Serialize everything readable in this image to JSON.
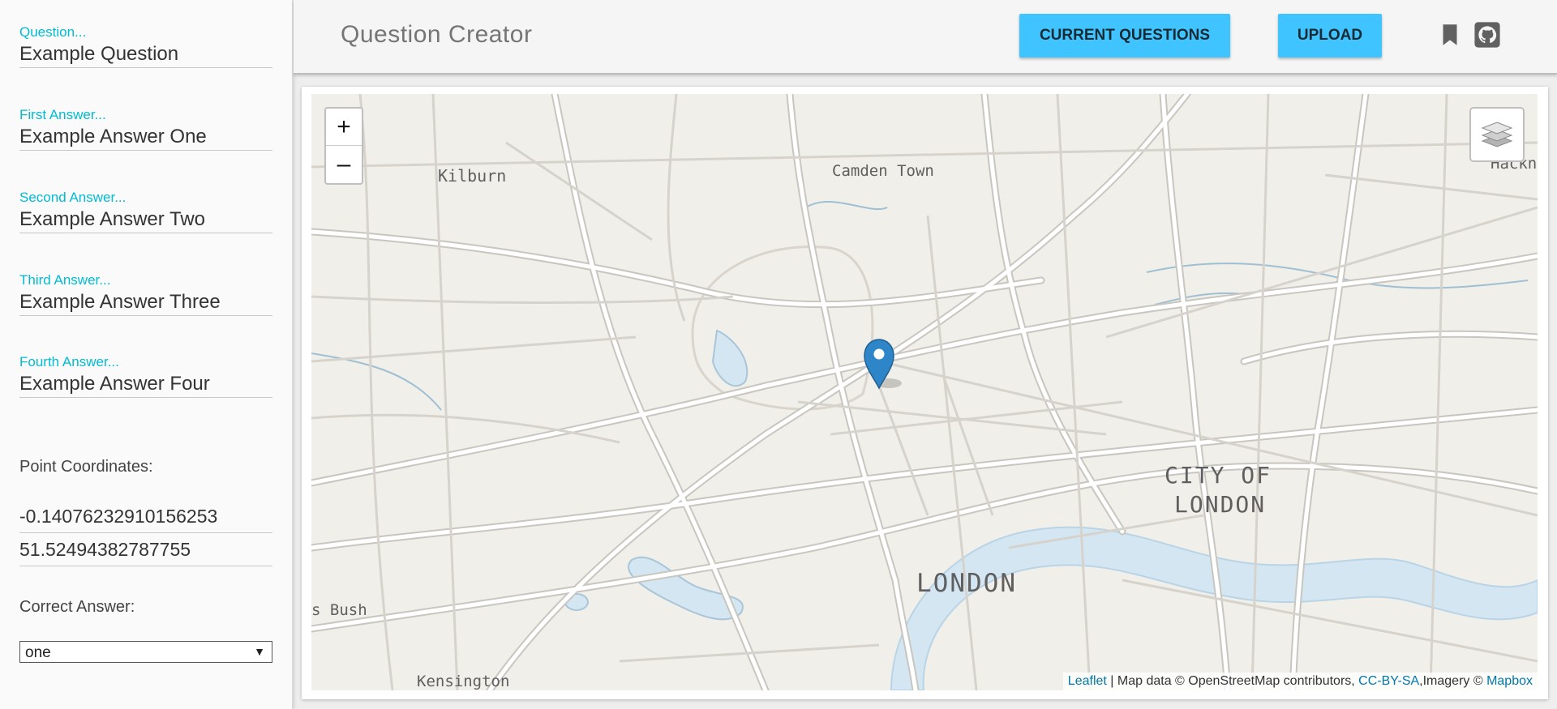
{
  "form": {
    "question": {
      "label": "Question...",
      "value": "Example Question"
    },
    "answer1": {
      "label": "First Answer...",
      "value": "Example Answer One"
    },
    "answer2": {
      "label": "Second Answer...",
      "value": "Example Answer Two"
    },
    "answer3": {
      "label": "Third Answer...",
      "value": "Example Answer Three"
    },
    "answer4": {
      "label": "Fourth Answer...",
      "value": "Example Answer Four"
    },
    "coordinates_label": "Point Coordinates:",
    "longitude": "-0.14076232910156253",
    "latitude": "51.52494382787755",
    "correct_label": "Correct Answer:",
    "correct_value": "one"
  },
  "header": {
    "title": "Question Creator",
    "current_questions_label": "CURRENT QUESTIONS",
    "upload_label": "UPLOAD",
    "icons": [
      "bookmark-icon",
      "github-icon"
    ]
  },
  "map": {
    "zoom_in": "+",
    "zoom_out": "–",
    "places": {
      "kilburn": "Kilburn",
      "camden": "Camden Town",
      "hackney": "Hackn",
      "city1": "CITY OF",
      "city2": "LONDON",
      "london": "LONDON",
      "bush": "s Bush",
      "kensington": "Kensington"
    },
    "attribution": {
      "leaflet": "Leaflet",
      "sep": " | ",
      "mapdata": "Map data © OpenStreetMap contributors, ",
      "ccbysa": "CC-BY-SA",
      "imagery": ",Imagery © ",
      "mapbox": "Mapbox"
    },
    "colors": {
      "land": "#f1efe9",
      "road": "#ffffff",
      "road_casing": "#c9c6c0",
      "water": "#d3e6f2",
      "marker": "#2e86c8"
    }
  }
}
